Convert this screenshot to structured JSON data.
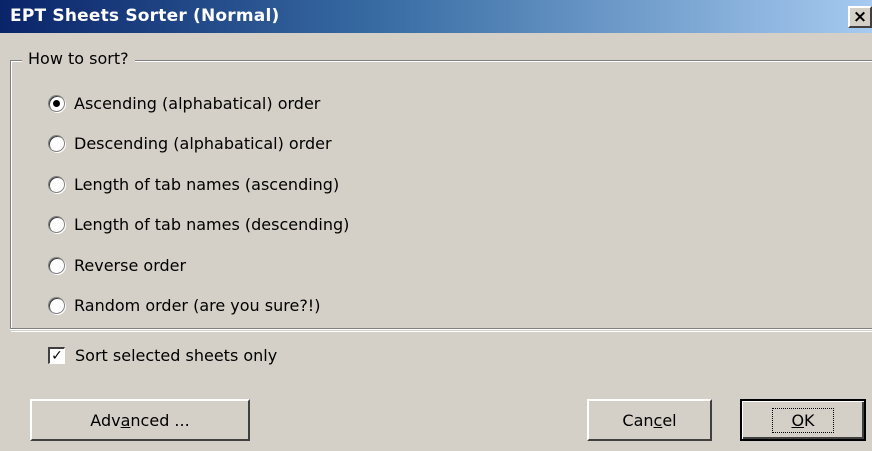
{
  "window": {
    "title": "EPT Sheets Sorter (Normal)",
    "close_glyph": "×"
  },
  "group": {
    "legend": "How to sort?"
  },
  "options": [
    {
      "label": "Ascending (alphabatical) order",
      "checked": true
    },
    {
      "label": "Descending (alphabatical) order",
      "checked": false
    },
    {
      "label": "Length of tab names (ascending)",
      "checked": false
    },
    {
      "label": "Length of tab names (descending)",
      "checked": false
    },
    {
      "label": "Reverse order",
      "checked": false
    },
    {
      "label": "Random order (are you sure?!)",
      "checked": false
    }
  ],
  "selected_only": {
    "label": "Sort selected sheets only",
    "checked": true,
    "check_glyph": "✓"
  },
  "buttons": {
    "advanced": {
      "pre": "Adv",
      "mnemonic": "a",
      "post": "nced ..."
    },
    "cancel": {
      "pre": "Can",
      "mnemonic": "c",
      "post": "el"
    },
    "ok": {
      "pre": "",
      "mnemonic": "O",
      "post": "K"
    }
  }
}
